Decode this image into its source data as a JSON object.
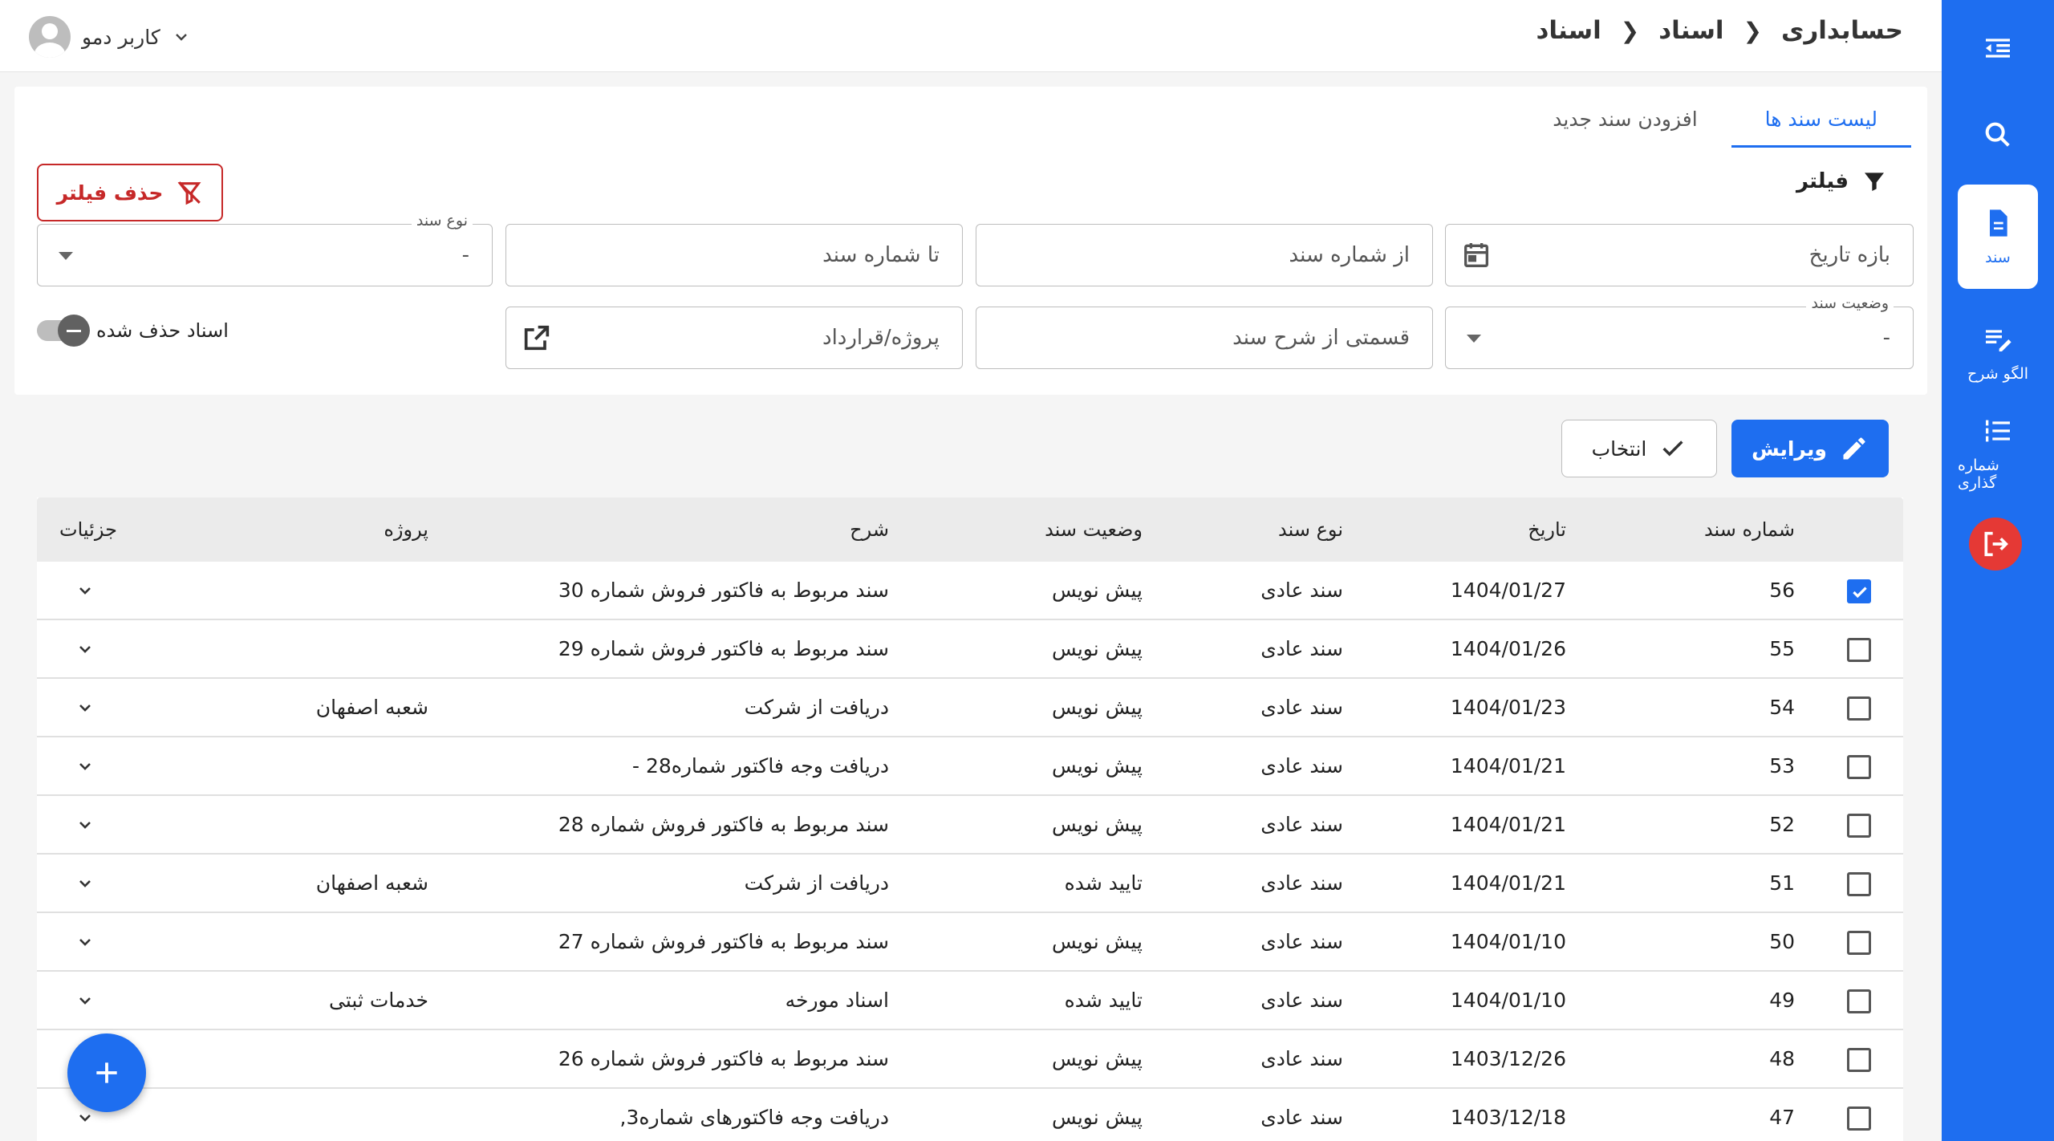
{
  "header": {
    "breadcrumb": [
      "حسابداری",
      "اسناد",
      "اسناد"
    ],
    "user_name": "کاربر دمو"
  },
  "sidebar": {
    "items": [
      {
        "label": "",
        "icon": "menu-collapse-icon"
      },
      {
        "label": "",
        "icon": "search-icon"
      },
      {
        "label": "سند",
        "icon": "document-icon",
        "active": true
      },
      {
        "label": "الگو شرح",
        "icon": "edit-note-icon"
      },
      {
        "label": "شماره گذاری",
        "icon": "numbered-list-icon"
      },
      {
        "label": "",
        "icon": "logout-icon"
      }
    ]
  },
  "tabs": {
    "list": "لیست سند ها",
    "add": "افزودن سند جدید"
  },
  "filter": {
    "title": "فیلتر",
    "clear_button": "حذف فیلتر",
    "date_range_placeholder": "بازه تاریخ",
    "from_number_placeholder": "از شماره سند",
    "to_number_placeholder": "تا شماره سند",
    "doc_type_label": "نوع سند",
    "doc_type_value": "-",
    "status_label": "وضعیت سند",
    "status_value": "-",
    "description_placeholder": "قسمتی از شرح سند",
    "project_placeholder": "پروژه/قرارداد",
    "deleted_toggle_label": "اسناد حذف شده"
  },
  "actions": {
    "edit": "ویرایش",
    "select": "انتخاب"
  },
  "table": {
    "columns": {
      "number": "شماره سند",
      "date": "تاریخ",
      "type": "نوع سند",
      "status": "وضعیت سند",
      "description": "شرح",
      "project": "پروژه",
      "details": "جزئیات"
    },
    "rows": [
      {
        "checked": true,
        "number": "56",
        "date": "1404/01/27",
        "type": "سند عادی",
        "status": "پیش نویس",
        "description": "سند مربوط به فاکتور فروش شماره 30",
        "project": ""
      },
      {
        "checked": false,
        "number": "55",
        "date": "1404/01/26",
        "type": "سند عادی",
        "status": "پیش نویس",
        "description": "سند مربوط به فاکتور فروش شماره 29",
        "project": ""
      },
      {
        "checked": false,
        "number": "54",
        "date": "1404/01/23",
        "type": "سند عادی",
        "status": "پیش نویس",
        "description": "دریافت از شرکت",
        "project": "شعبه اصفهان"
      },
      {
        "checked": false,
        "number": "53",
        "date": "1404/01/21",
        "type": "سند عادی",
        "status": "پیش نویس",
        "description": "دریافت وجه فاکتور شماره28 -",
        "project": ""
      },
      {
        "checked": false,
        "number": "52",
        "date": "1404/01/21",
        "type": "سند عادی",
        "status": "پیش نویس",
        "description": "سند مربوط به فاکتور فروش شماره 28",
        "project": ""
      },
      {
        "checked": false,
        "number": "51",
        "date": "1404/01/21",
        "type": "سند عادی",
        "status": "تایید شده",
        "description": "دریافت از شرکت",
        "project": "شعبه اصفهان"
      },
      {
        "checked": false,
        "number": "50",
        "date": "1404/01/10",
        "type": "سند عادی",
        "status": "پیش نویس",
        "description": "سند مربوط به فاکتور فروش شماره 27",
        "project": ""
      },
      {
        "checked": false,
        "number": "49",
        "date": "1404/01/10",
        "type": "سند عادی",
        "status": "تایید شده",
        "description": "اسناد مورخه",
        "project": "خدمات ثبتی"
      },
      {
        "checked": false,
        "number": "48",
        "date": "1403/12/26",
        "type": "سند عادی",
        "status": "پیش نویس",
        "description": "سند مربوط به فاکتور فروش شماره 26",
        "project": ""
      },
      {
        "checked": false,
        "number": "47",
        "date": "1403/12/18",
        "type": "سند عادی",
        "status": "پیش نویس",
        "description": "دریافت وجه فاکتورهای شماره3,",
        "project": ""
      }
    ]
  },
  "colors": {
    "primary": "#1e6ef0",
    "danger": "#c62828",
    "logout": "#e53935",
    "header_bg": "#ebebeb"
  }
}
